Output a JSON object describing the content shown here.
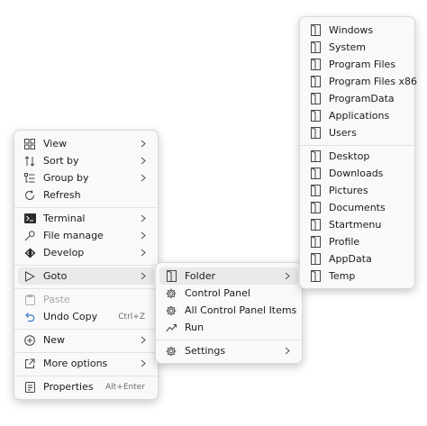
{
  "context_menu": {
    "items": [
      {
        "label": "View",
        "icon": "grid-icon"
      },
      {
        "label": "Sort by",
        "icon": "sort-icon"
      },
      {
        "label": "Group by",
        "icon": "group-icon"
      },
      {
        "label": "Refresh",
        "icon": "refresh-icon"
      },
      {
        "label": "Terminal",
        "icon": "terminal-icon"
      },
      {
        "label": "File manage",
        "icon": "wrench-icon"
      },
      {
        "label": "Develop",
        "icon": "code-icon"
      },
      {
        "label": "Goto",
        "icon": "arrow-pointer-icon"
      },
      {
        "label": "Paste",
        "icon": "clipboard-icon"
      },
      {
        "label": "Undo Copy",
        "icon": "undo-icon",
        "shortcut": "Ctrl+Z"
      },
      {
        "label": "New",
        "icon": "plus-circle-icon"
      },
      {
        "label": "More options",
        "icon": "share-icon"
      },
      {
        "label": "Properties",
        "icon": "properties-icon",
        "shortcut": "Alt+Enter"
      }
    ]
  },
  "goto_menu": {
    "items": [
      {
        "label": "Folder",
        "icon": "folder-icon"
      },
      {
        "label": "Control Panel",
        "icon": "gear-icon"
      },
      {
        "label": "All Control Panel Items",
        "icon": "gear-icon"
      },
      {
        "label": "Run",
        "icon": "run-icon"
      },
      {
        "label": "Settings",
        "icon": "gear-icon"
      }
    ]
  },
  "folder_menu": {
    "items": [
      {
        "label": "Windows"
      },
      {
        "label": "System"
      },
      {
        "label": "Program Files"
      },
      {
        "label": "Program Files x86"
      },
      {
        "label": "ProgramData"
      },
      {
        "label": "Applications"
      },
      {
        "label": "Users"
      },
      {
        "label": "Desktop"
      },
      {
        "label": "Downloads"
      },
      {
        "label": "Pictures"
      },
      {
        "label": "Documents"
      },
      {
        "label": "Startmenu"
      },
      {
        "label": "Profile"
      },
      {
        "label": "AppData"
      },
      {
        "label": "Temp"
      }
    ]
  }
}
